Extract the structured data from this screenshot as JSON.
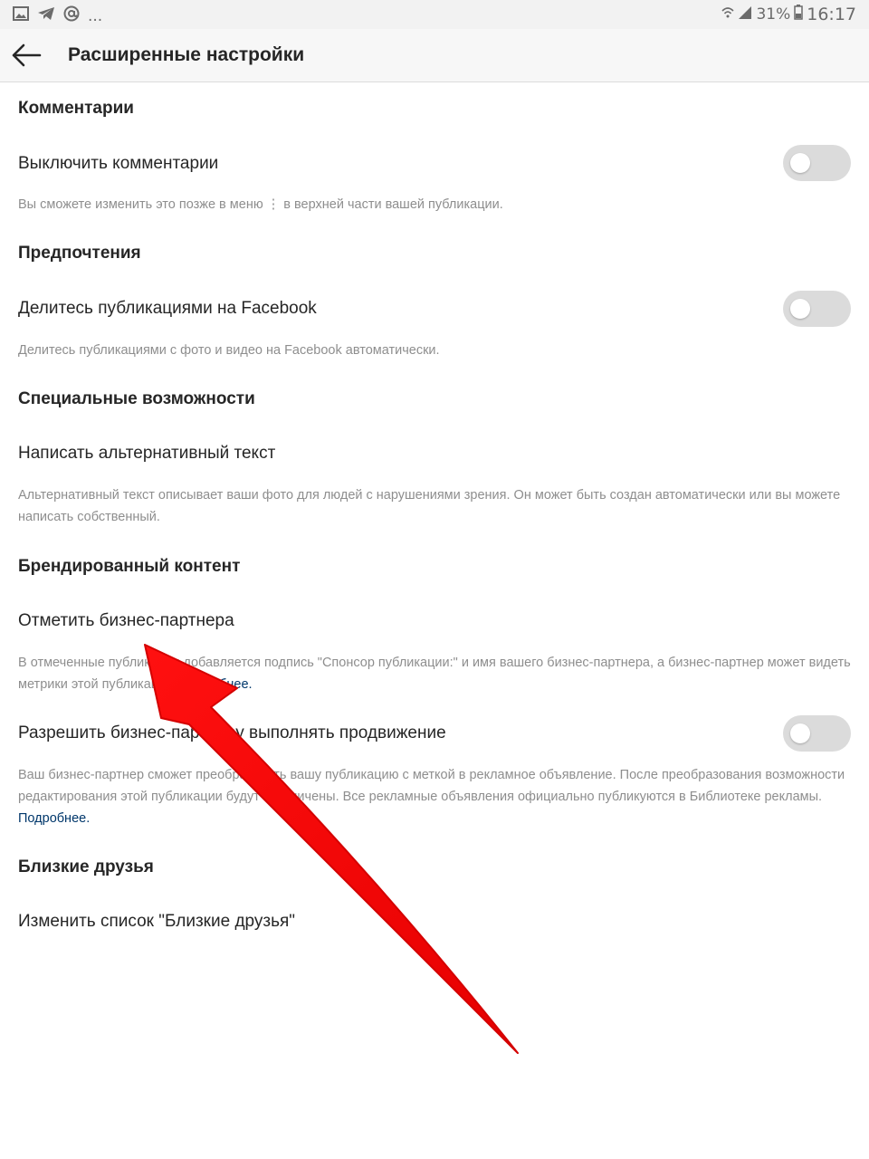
{
  "status_bar": {
    "left_icons": [
      "image-icon",
      "telegram-icon",
      "at-icon"
    ],
    "overflow": "...",
    "battery_percent": "31%",
    "time": "16:17"
  },
  "header": {
    "title": "Расширенные настройки"
  },
  "sections": {
    "comments": {
      "heading": "Комментарии",
      "item_label": "Выключить комментарии",
      "toggle_on": false,
      "description": "Вы сможете изменить это позже в меню ⋮ в верхней части вашей публикации."
    },
    "preferences": {
      "heading": "Предпочтения",
      "item_label": "Делитесь публикациями на Facebook",
      "toggle_on": false,
      "description": "Делитесь публикациями с фото и видео на Facebook автоматически."
    },
    "accessibility": {
      "heading": "Специальные возможности",
      "item_label": "Написать альтернативный текст",
      "description": "Альтернативный текст описывает ваши фото для людей с нарушениями зрения. Он может быть создан автоматически или вы можете написать собственный."
    },
    "branded": {
      "heading": "Брендированный контент",
      "tag_label": "Отметить бизнес-партнера",
      "tag_description": "В отмеченные публикации добавляется подпись \"Спонсор публикации:\" и имя вашего бизнес-партнера, а бизнес-партнер может видеть метрики этой публикации.",
      "tag_link": "Подробнее.",
      "promote_label": "Разрешить бизнес-партнеру выполнять продвижение",
      "promote_toggle_on": false,
      "promote_description": "Ваш бизнес-партнер сможет преобразовать вашу публикацию с меткой в рекламное объявление. После преобразования возможности редактирования этой публикации будут ограничены. Все рекламные объявления официально публикуются в Библиотеке рекламы.",
      "promote_link": "Подробнее."
    },
    "close_friends": {
      "heading": "Близкие друзья",
      "item_label": "Изменить список \"Близкие друзья\""
    }
  },
  "colors": {
    "annotation_arrow": "#ff1a1a",
    "link": "#00376b",
    "toggle_off": "#dbdbdb"
  }
}
